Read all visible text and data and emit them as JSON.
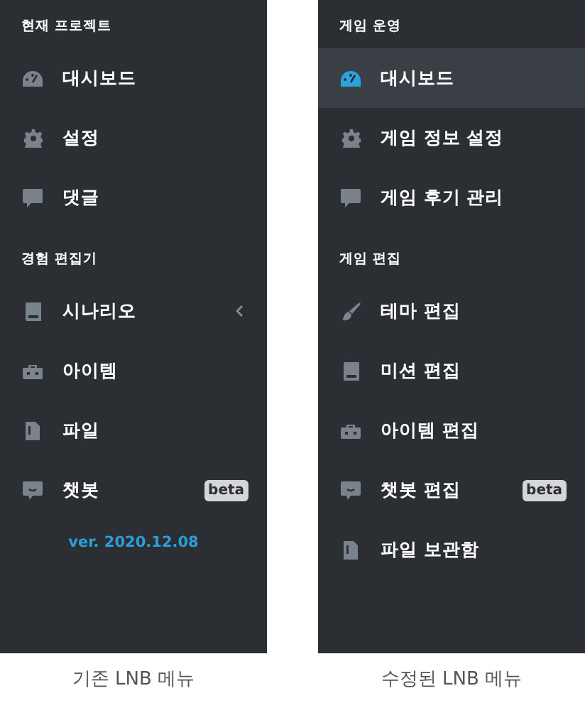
{
  "panels": [
    {
      "groups": [
        {
          "title": "현재 프로젝트",
          "items": [
            {
              "label": "대시보드",
              "selected": false,
              "submenu": false
            },
            {
              "label": "설정",
              "selected": false,
              "submenu": false
            },
            {
              "label": "댓글",
              "selected": false,
              "submenu": false
            }
          ]
        },
        {
          "title": "경험 편집기",
          "items": [
            {
              "label": "시나리오",
              "selected": false,
              "submenu": true
            },
            {
              "label": "아이템",
              "selected": false,
              "submenu": false
            },
            {
              "label": "파일",
              "selected": false,
              "submenu": false
            },
            {
              "label": "챗봇",
              "selected": false,
              "submenu": false,
              "badge": "beta"
            }
          ]
        }
      ],
      "version": "ver. 2020.12.08",
      "caption": "기존 LNB 메뉴"
    },
    {
      "groups": [
        {
          "title": "게임 운영",
          "items": [
            {
              "label": "대시보드",
              "selected": true,
              "submenu": false
            },
            {
              "label": "게임 정보 설정",
              "selected": false,
              "submenu": false
            },
            {
              "label": "게임 후기 관리",
              "selected": false,
              "submenu": false
            }
          ]
        },
        {
          "title": "게임 편집",
          "items": [
            {
              "label": "테마 편집",
              "selected": false,
              "submenu": false
            },
            {
              "label": "미션 편집",
              "selected": false,
              "submenu": false
            },
            {
              "label": "아이템 편집",
              "selected": false,
              "submenu": false
            },
            {
              "label": "챗봇 편집",
              "selected": false,
              "submenu": false,
              "badge": "beta"
            },
            {
              "label": "파일 보관함",
              "selected": false,
              "submenu": false
            }
          ]
        }
      ],
      "caption": "수정된 LNB 메뉴"
    }
  ]
}
